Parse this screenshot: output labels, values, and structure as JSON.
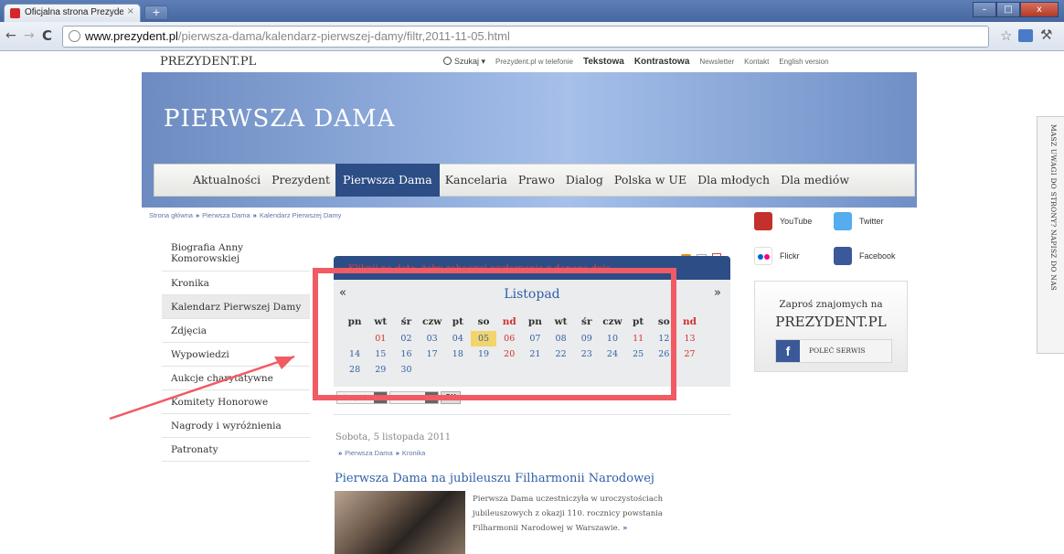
{
  "browser": {
    "tab_title": "Oficjalna strona Prezydenta",
    "tab_close": "×",
    "new_tab": "+",
    "url_host": "www.prezydent.pl",
    "url_path": "/pierwsza-dama/kalendarz-pierwszej-damy/filtr,2011-11-05.html",
    "win_min": "–",
    "win_max": "□",
    "win_close": "x"
  },
  "header": {
    "logo": "PREZYDENT.PL",
    "search": "Szukaj ▾",
    "phone": "Prezydent.pl w telefonie",
    "text_version": "Tekstowa",
    "contrast_version": "Kontrastowa",
    "newsletter": "Newsletter",
    "contact": "Kontakt",
    "english": "English version",
    "section_title": "PIERWSZA DAMA"
  },
  "mainnav": [
    "Aktualności",
    "Prezydent",
    "Pierwsza Dama",
    "Kancelaria",
    "Prawo",
    "Dialog",
    "Polska w UE",
    "Dla młodych",
    "Dla mediów"
  ],
  "breadcrumb": [
    "Strona główna",
    "Pierwsza Dama",
    "Kalendarz Pierwszej Damy"
  ],
  "breadcrumb_sep": "»",
  "sidebar": [
    "Biografia Anny Komorowskiej",
    "Kronika",
    "Kalendarz Pierwszej Damy",
    "Zdjęcia",
    "Wypowiedzi",
    "Aukcje charytatywne",
    "Komitety Honorowe",
    "Nagrody i wyróżnienia",
    "Patronaty"
  ],
  "tools": {
    "a1": "A",
    "a2": "A",
    "a3": "A"
  },
  "calendar": {
    "banner": "Kliknij na datę, żeby zobaczyć wydarzenia z danego dnia",
    "prev": "«",
    "next": "»",
    "month": "Listopad",
    "day_headers": [
      "pn",
      "wt",
      "śr",
      "czw",
      "pt",
      "so",
      "nd",
      "pn",
      "wt",
      "śr",
      "czw",
      "pt",
      "so",
      "nd"
    ],
    "rows": [
      [
        "",
        "01",
        "02",
        "03",
        "04",
        "05",
        "06",
        "07",
        "08",
        "09",
        "10",
        "11",
        "12",
        "13"
      ],
      [
        "14",
        "15",
        "16",
        "17",
        "18",
        "19",
        "20",
        "21",
        "22",
        "23",
        "24",
        "25",
        "26",
        "27"
      ],
      [
        "28",
        "29",
        "30",
        "",
        "",
        "",
        "",
        "",
        "",
        "",
        "",
        "",
        "",
        ""
      ]
    ],
    "selected": "05",
    "red_days": [
      "01",
      "06",
      "11",
      "13",
      "20",
      "27"
    ],
    "month_select": "Listopad",
    "year_select": "2011",
    "ok": "OK"
  },
  "events": {
    "date_heading": "Sobota, 5 listopada 2011",
    "crumb": [
      "Pierwsza Dama",
      "Kronika"
    ],
    "article_title": "Pierwsza Dama na jubileuszu Filharmonii Narodowej",
    "article_line1": "Pierwsza Dama uczestniczyła w uroczystościach",
    "article_line2": "jubileuszowych z okazji 110. rocznicy powstania",
    "article_line3": "Filharmonii Narodowej w Warszawie.",
    "more": "»"
  },
  "social": {
    "youtube": "YouTube",
    "twitter": "Twitter",
    "flickr": "Flickr",
    "facebook": "Facebook"
  },
  "invite": {
    "line1": "Zaproś znajomych na",
    "line2": "PREZYDENT.PL",
    "button": "POLEĆ SERWIS",
    "fb": "f"
  },
  "feedback": "MASZ UWAGI DO STRONY? NAPISZ DO NAS",
  "annotation_color": "#f05b64"
}
